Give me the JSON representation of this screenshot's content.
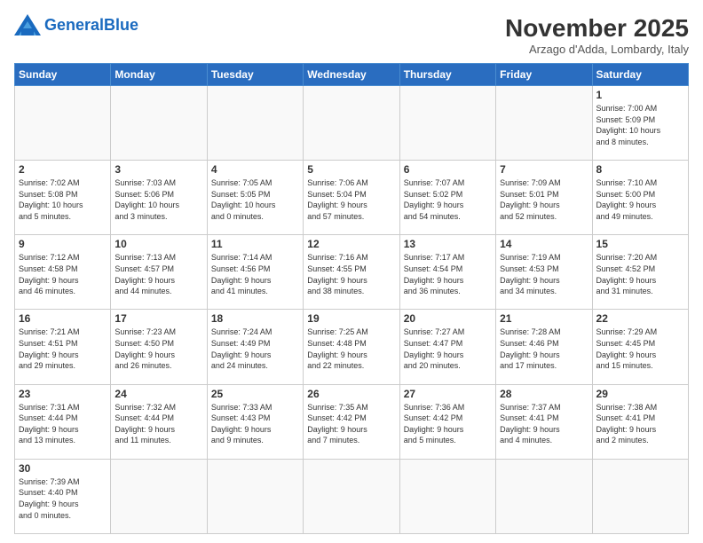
{
  "header": {
    "logo_general": "General",
    "logo_blue": "Blue",
    "month_title": "November 2025",
    "subtitle": "Arzago d'Adda, Lombardy, Italy"
  },
  "days_of_week": [
    "Sunday",
    "Monday",
    "Tuesday",
    "Wednesday",
    "Thursday",
    "Friday",
    "Saturday"
  ],
  "weeks": [
    [
      {
        "num": "",
        "info": ""
      },
      {
        "num": "",
        "info": ""
      },
      {
        "num": "",
        "info": ""
      },
      {
        "num": "",
        "info": ""
      },
      {
        "num": "",
        "info": ""
      },
      {
        "num": "",
        "info": ""
      },
      {
        "num": "1",
        "info": "Sunrise: 7:00 AM\nSunset: 5:09 PM\nDaylight: 10 hours\nand 8 minutes."
      }
    ],
    [
      {
        "num": "2",
        "info": "Sunrise: 7:02 AM\nSunset: 5:08 PM\nDaylight: 10 hours\nand 5 minutes."
      },
      {
        "num": "3",
        "info": "Sunrise: 7:03 AM\nSunset: 5:06 PM\nDaylight: 10 hours\nand 3 minutes."
      },
      {
        "num": "4",
        "info": "Sunrise: 7:05 AM\nSunset: 5:05 PM\nDaylight: 10 hours\nand 0 minutes."
      },
      {
        "num": "5",
        "info": "Sunrise: 7:06 AM\nSunset: 5:04 PM\nDaylight: 9 hours\nand 57 minutes."
      },
      {
        "num": "6",
        "info": "Sunrise: 7:07 AM\nSunset: 5:02 PM\nDaylight: 9 hours\nand 54 minutes."
      },
      {
        "num": "7",
        "info": "Sunrise: 7:09 AM\nSunset: 5:01 PM\nDaylight: 9 hours\nand 52 minutes."
      },
      {
        "num": "8",
        "info": "Sunrise: 7:10 AM\nSunset: 5:00 PM\nDaylight: 9 hours\nand 49 minutes."
      }
    ],
    [
      {
        "num": "9",
        "info": "Sunrise: 7:12 AM\nSunset: 4:58 PM\nDaylight: 9 hours\nand 46 minutes."
      },
      {
        "num": "10",
        "info": "Sunrise: 7:13 AM\nSunset: 4:57 PM\nDaylight: 9 hours\nand 44 minutes."
      },
      {
        "num": "11",
        "info": "Sunrise: 7:14 AM\nSunset: 4:56 PM\nDaylight: 9 hours\nand 41 minutes."
      },
      {
        "num": "12",
        "info": "Sunrise: 7:16 AM\nSunset: 4:55 PM\nDaylight: 9 hours\nand 38 minutes."
      },
      {
        "num": "13",
        "info": "Sunrise: 7:17 AM\nSunset: 4:54 PM\nDaylight: 9 hours\nand 36 minutes."
      },
      {
        "num": "14",
        "info": "Sunrise: 7:19 AM\nSunset: 4:53 PM\nDaylight: 9 hours\nand 34 minutes."
      },
      {
        "num": "15",
        "info": "Sunrise: 7:20 AM\nSunset: 4:52 PM\nDaylight: 9 hours\nand 31 minutes."
      }
    ],
    [
      {
        "num": "16",
        "info": "Sunrise: 7:21 AM\nSunset: 4:51 PM\nDaylight: 9 hours\nand 29 minutes."
      },
      {
        "num": "17",
        "info": "Sunrise: 7:23 AM\nSunset: 4:50 PM\nDaylight: 9 hours\nand 26 minutes."
      },
      {
        "num": "18",
        "info": "Sunrise: 7:24 AM\nSunset: 4:49 PM\nDaylight: 9 hours\nand 24 minutes."
      },
      {
        "num": "19",
        "info": "Sunrise: 7:25 AM\nSunset: 4:48 PM\nDaylight: 9 hours\nand 22 minutes."
      },
      {
        "num": "20",
        "info": "Sunrise: 7:27 AM\nSunset: 4:47 PM\nDaylight: 9 hours\nand 20 minutes."
      },
      {
        "num": "21",
        "info": "Sunrise: 7:28 AM\nSunset: 4:46 PM\nDaylight: 9 hours\nand 17 minutes."
      },
      {
        "num": "22",
        "info": "Sunrise: 7:29 AM\nSunset: 4:45 PM\nDaylight: 9 hours\nand 15 minutes."
      }
    ],
    [
      {
        "num": "23",
        "info": "Sunrise: 7:31 AM\nSunset: 4:44 PM\nDaylight: 9 hours\nand 13 minutes."
      },
      {
        "num": "24",
        "info": "Sunrise: 7:32 AM\nSunset: 4:44 PM\nDaylight: 9 hours\nand 11 minutes."
      },
      {
        "num": "25",
        "info": "Sunrise: 7:33 AM\nSunset: 4:43 PM\nDaylight: 9 hours\nand 9 minutes."
      },
      {
        "num": "26",
        "info": "Sunrise: 7:35 AM\nSunset: 4:42 PM\nDaylight: 9 hours\nand 7 minutes."
      },
      {
        "num": "27",
        "info": "Sunrise: 7:36 AM\nSunset: 4:42 PM\nDaylight: 9 hours\nand 5 minutes."
      },
      {
        "num": "28",
        "info": "Sunrise: 7:37 AM\nSunset: 4:41 PM\nDaylight: 9 hours\nand 4 minutes."
      },
      {
        "num": "29",
        "info": "Sunrise: 7:38 AM\nSunset: 4:41 PM\nDaylight: 9 hours\nand 2 minutes."
      }
    ],
    [
      {
        "num": "30",
        "info": "Sunrise: 7:39 AM\nSunset: 4:40 PM\nDaylight: 9 hours\nand 0 minutes."
      },
      {
        "num": "",
        "info": ""
      },
      {
        "num": "",
        "info": ""
      },
      {
        "num": "",
        "info": ""
      },
      {
        "num": "",
        "info": ""
      },
      {
        "num": "",
        "info": ""
      },
      {
        "num": "",
        "info": ""
      }
    ]
  ]
}
